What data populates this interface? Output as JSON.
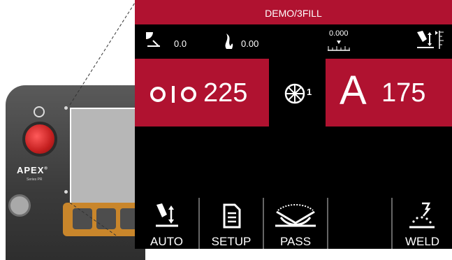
{
  "device": {
    "brand": "APEX",
    "brand_mark": "®",
    "model": "Series PR"
  },
  "screen": {
    "title": "DEMO/3FILL",
    "status": {
      "distance_value": "0.0",
      "heat_value": "0.00",
      "ruler_value": "0.000"
    },
    "wire_feed": {
      "value": "225"
    },
    "pass_number": "1",
    "amperage": {
      "unit": "A",
      "value": "175"
    },
    "buttons": [
      {
        "label": "AUTO",
        "icon": "torch-auto-icon"
      },
      {
        "label": "SETUP",
        "icon": "document-icon"
      },
      {
        "label": "PASS",
        "icon": "weave-pass-icon"
      },
      {
        "label": "",
        "icon": ""
      },
      {
        "label": "WELD",
        "icon": "weld-torch-icon"
      }
    ]
  },
  "colors": {
    "accent": "#b01230",
    "background": "#000000",
    "text": "#ffffff"
  }
}
